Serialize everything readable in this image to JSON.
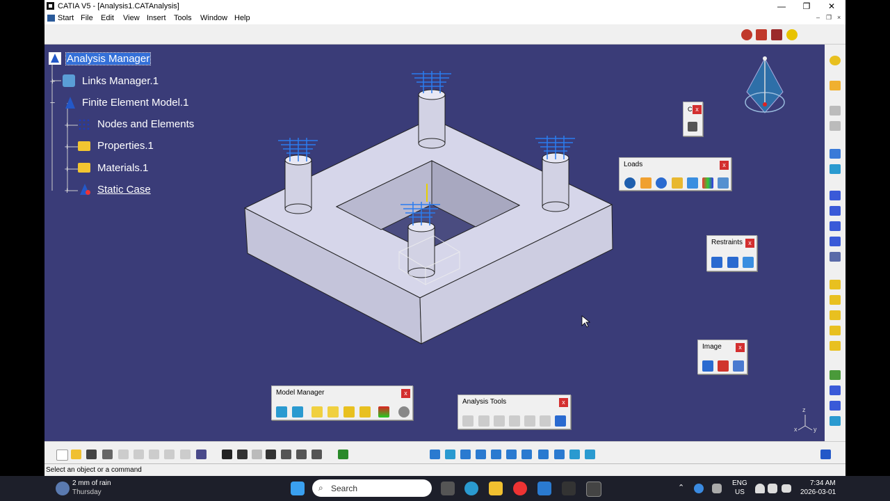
{
  "window": {
    "title": "CATIA V5 - [Analysis1.CATAnalysis]",
    "minimize": "—",
    "maximize": "❐",
    "close": "✕"
  },
  "menu": {
    "items": [
      "Start",
      "File",
      "Edit",
      "View",
      "Insert",
      "Tools",
      "Window",
      "Help"
    ]
  },
  "mdi_controls": [
    "–",
    "❐",
    "×"
  ],
  "tree": {
    "root": "Analysis Manager",
    "links_manager": "Links Manager.1",
    "fem": "Finite Element Model.1",
    "nodes": "Nodes and Elements",
    "properties": "Properties.1",
    "materials": "Materials.1",
    "static_case": "Static Case"
  },
  "panels": {
    "loads": "Loads",
    "restraints": "Restraints",
    "image": "Image",
    "model_manager": "Model Manager",
    "analysis_tools": "Analysis Tools",
    "small_c": "C",
    "close_x": "x"
  },
  "status": {
    "prompt": "Select an object or a command"
  },
  "taskbar": {
    "weather_temp": "2 mm of rain",
    "weather_day": "Thursday",
    "search_placeholder": "Search",
    "lang1": "ENG",
    "lang2": "US",
    "time": "7:34 AM",
    "date": "2026-03-01"
  },
  "compass_axes": {
    "x": "x",
    "y": "y",
    "z": "z"
  },
  "colors": {
    "viewport": "#3a3c78",
    "selection": "#3470d8",
    "part_top": "#d6d6ea",
    "part_side": "#c4c4da",
    "restraint": "#2a7cf0"
  }
}
